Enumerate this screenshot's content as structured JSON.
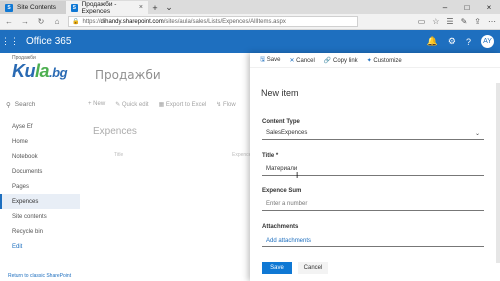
{
  "browser": {
    "tabs": [
      {
        "label": "Site Contents",
        "active": false
      },
      {
        "label": "Продажби - Expences",
        "active": true
      }
    ],
    "new_tab": "+",
    "tab_dropdown": "⌄",
    "url_scheme": "https://",
    "url_host": "dihandy.sharepoint.com",
    "url_path": "/sites/aula/sales/Lists/Expences/AllItems.aspx"
  },
  "suite": {
    "brand": "Office 365",
    "avatar_initials": "AY"
  },
  "site": {
    "small_label": "Продажби",
    "logo_main": "Ku",
    "logo_o": "la",
    "logo_tld": ".bg",
    "title": "Продажби"
  },
  "leftnav": {
    "search_placeholder": "Search",
    "items": [
      {
        "label": "Ayse Ef",
        "active": false
      },
      {
        "label": "Home",
        "active": false
      },
      {
        "label": "Notebook",
        "active": false
      },
      {
        "label": "Documents",
        "active": false
      },
      {
        "label": "Pages",
        "active": false
      },
      {
        "label": "Expences",
        "active": true
      },
      {
        "label": "Site contents",
        "active": false
      },
      {
        "label": "Recycle bin",
        "active": false
      }
    ],
    "edit_label": "Edit",
    "classic_link": "Return to classic SharePoint"
  },
  "commandbar": {
    "new": "New",
    "quick_edit": "Quick edit",
    "export": "Export to Excel",
    "flow": "Flow"
  },
  "list": {
    "title": "Expences",
    "col_title": "Title",
    "col_expence": "Expence"
  },
  "panel": {
    "save": "Save",
    "cancel": "Cancel",
    "copy_link": "Copy link",
    "customize": "Customize",
    "heading": "New item",
    "content_type_label": "Content Type",
    "content_type_value": "SalesExpences",
    "title_label": "Title *",
    "title_value": "Материали",
    "sum_label": "Expence Sum",
    "sum_placeholder": "Enter a number",
    "attachments_label": "Attachments",
    "add_attachments": "Add attachments",
    "save_button": "Save",
    "cancel_button": "Cancel"
  }
}
